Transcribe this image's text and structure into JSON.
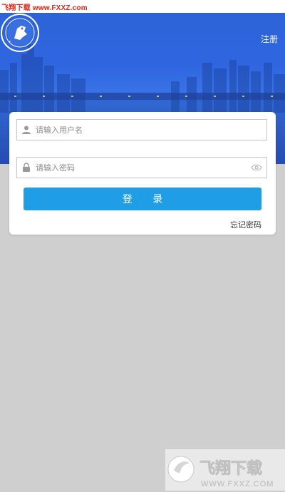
{
  "watermark": {
    "top_text": "飞翔下载 www.FXXZ.com",
    "bottom_brand": "飞翔下载",
    "bottom_url": "WWW.FXXZ.COM"
  },
  "header": {
    "close_icon": "close-icon",
    "register_label": "注册"
  },
  "hero": {
    "emblem_icon": "police-emblem"
  },
  "login_form": {
    "username": {
      "placeholder": "请输入用户名",
      "value": "",
      "icon": "user-icon"
    },
    "password": {
      "placeholder": "请输入密码",
      "value": "",
      "icon": "lock-icon",
      "toggle_icon": "eye-icon"
    },
    "submit_label": "登 录",
    "forgot_label": "忘记密码"
  },
  "colors": {
    "hero_blue": "#2f66e0",
    "button_blue": "#1f9ee5",
    "page_gray": "#cfcfcf"
  }
}
